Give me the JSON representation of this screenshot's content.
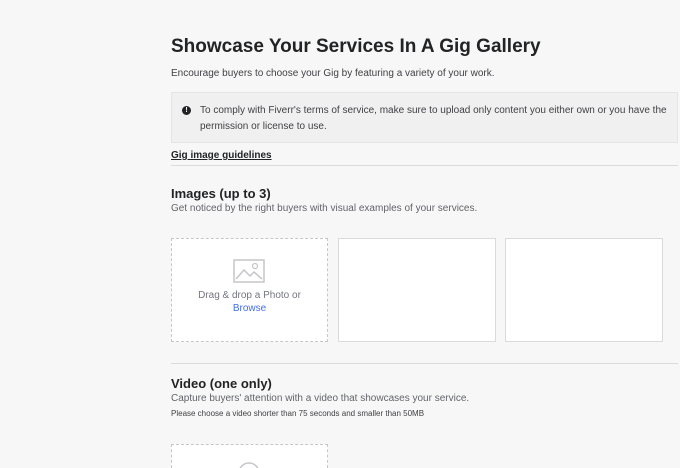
{
  "header": {
    "title": "Showcase Your Services In A Gig Gallery",
    "subtitle": "Encourage buyers to choose your Gig by featuring a variety of your work."
  },
  "notice": {
    "icon": "info-icon",
    "text": "To comply with Fiverr's terms of service, make sure to upload only content you either own or you have the permission or license to use."
  },
  "guidelines_link": "Gig image guidelines",
  "images": {
    "title": "Images (up to 3)",
    "description": "Get noticed by the right buyers with visual examples of your services.",
    "drop_text": "Drag & drop a Photo or",
    "browse_label": "Browse",
    "icon": "photo-icon"
  },
  "video": {
    "title": "Video (one only)",
    "description": "Capture buyers' attention with a video that showcases your service.",
    "note": "Please choose a video shorter than 75 seconds and smaller than 50MB",
    "icon": "video-icon"
  },
  "colors": {
    "background": "#f7f7f7",
    "link": "#446ee7",
    "text_dark": "#222325"
  }
}
